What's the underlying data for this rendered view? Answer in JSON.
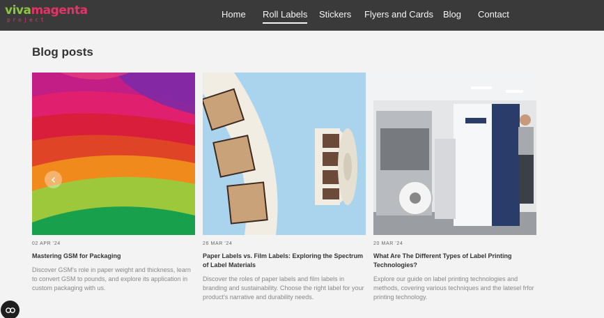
{
  "brand": {
    "logo_main_a": "viva",
    "logo_main_b": "magenta",
    "logo_sub": "project",
    "colors": {
      "green": "#8cc63f",
      "magenta": "#e2336b"
    }
  },
  "nav": {
    "items": [
      {
        "label": "Home"
      },
      {
        "label": "Roll Labels",
        "active": true
      },
      {
        "label": "Stickers"
      },
      {
        "label": "Flyers and Cards"
      },
      {
        "label": "Blog"
      },
      {
        "label": "Contact"
      }
    ]
  },
  "page": {
    "title": "Blog posts"
  },
  "posts": [
    {
      "date": "02 APR '24",
      "title": "Mastering GSM for Packaging",
      "excerpt": "Discover GSM's role in paper weight and thickness, learn to convert GSM to pounds, and explore its application in custom packaging with us."
    },
    {
      "date": "26 MAR '24",
      "title": "Paper Labels vs. Film Labels: Exploring the Spectrum of Label Materials",
      "excerpt": "Discover the roles of paper labels and film labels in branding and sustainability. Choose the right label for your product's narrative and durability needs."
    },
    {
      "date": "20 MAR '24",
      "title": "What Are The Different Types of Label Printing Technologies?",
      "excerpt": "Explore our guide on label printing technologies and methods, covering various techniques and the latesel frfor printing technology."
    }
  ],
  "icons": {
    "slider_prev": "chevron-left-icon",
    "cookie": "cookie-settings-icon"
  }
}
